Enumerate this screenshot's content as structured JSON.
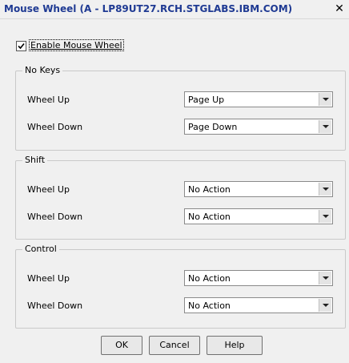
{
  "window": {
    "title": "Mouse Wheel (A - LP89UT27.RCH.STGLABS.IBM.COM)",
    "close_glyph": "✕"
  },
  "enable_checkbox": {
    "label": "Enable Mouse Wheel",
    "checked": true
  },
  "groups": [
    {
      "title": "No Keys",
      "wheel_up_label": "Wheel Up",
      "wheel_up_value": "Page Up",
      "wheel_down_label": "Wheel Down",
      "wheel_down_value": "Page Down"
    },
    {
      "title": "Shift",
      "wheel_up_label": "Wheel Up",
      "wheel_up_value": "No Action",
      "wheel_down_label": "Wheel Down",
      "wheel_down_value": "No Action"
    },
    {
      "title": "Control",
      "wheel_up_label": "Wheel Up",
      "wheel_up_value": "No Action",
      "wheel_down_label": "Wheel Down",
      "wheel_down_value": "No Action"
    }
  ],
  "buttons": {
    "ok": "OK",
    "cancel": "Cancel",
    "help": "Help"
  },
  "colors": {
    "title_text": "#1f3a93",
    "background": "#f0f0f0"
  }
}
